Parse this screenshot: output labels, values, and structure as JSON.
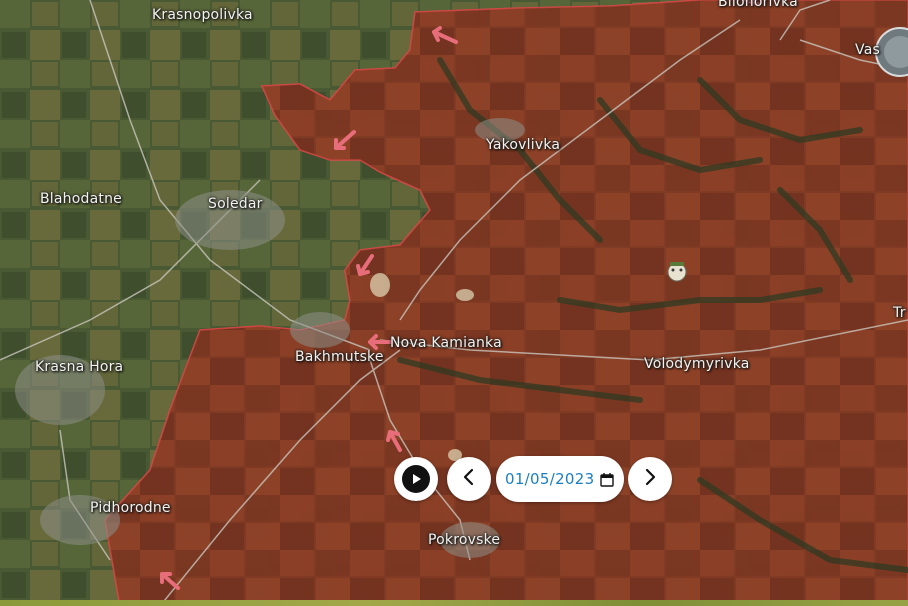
{
  "map": {
    "labels": [
      {
        "id": "krasnopolivka",
        "text": "Krasnopolivka"
      },
      {
        "id": "bilohorivka",
        "text": "Bilohorivka"
      },
      {
        "id": "vas",
        "text": "Vas"
      },
      {
        "id": "yakovlivka",
        "text": "Yakovlivka"
      },
      {
        "id": "blahodatne",
        "text": "Blahodatne"
      },
      {
        "id": "soledar",
        "text": "Soledar"
      },
      {
        "id": "nova-kamianka",
        "text": "Nova Kamianka"
      },
      {
        "id": "bakhmutske",
        "text": "Bakhmutske"
      },
      {
        "id": "krasna-hora",
        "text": "Krasna Hora"
      },
      {
        "id": "volodymyrivka",
        "text": "Volodymyrivka"
      },
      {
        "id": "tr",
        "text": "Tr"
      },
      {
        "id": "pidhorodne",
        "text": "Pidhorodne"
      },
      {
        "id": "pokrovske",
        "text": "Pokrovske"
      }
    ],
    "colors": {
      "occupied_fill": "#8a3a22",
      "occupied_border": "#e0484a",
      "arrow": "#e86d7a",
      "fields_dark": "#3f4a2c",
      "fields_light": "#7b7442"
    }
  },
  "timeline": {
    "date_value": "01/05/2023",
    "play_icon": "play-icon",
    "prev_icon": "chevron-left-icon",
    "next_icon": "chevron-right-icon",
    "calendar_icon": "calendar-icon"
  }
}
